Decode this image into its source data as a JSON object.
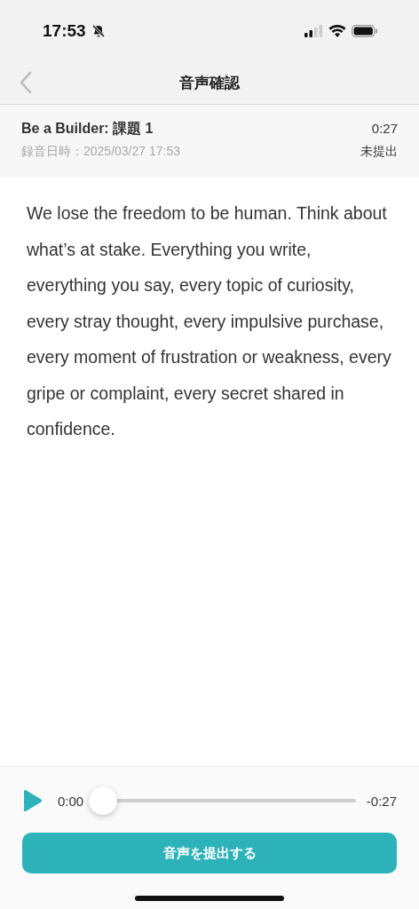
{
  "status_bar": {
    "time": "17:53",
    "silent": true
  },
  "nav": {
    "title": "音声確認"
  },
  "recording": {
    "title": "Be a Builder: 課題 1",
    "recorded_at": "録音日時：2025/03/27 17:53",
    "duration": "0:27",
    "status": "未提出"
  },
  "transcript": "We lose the freedom to be human. Think about what’s at stake. Everything you write, everything you say, every topic of curiosity, every stray thought, every impulsive purchase, every moment of frustration or weakness, every gripe or complaint, every secret shared in confidence.",
  "player": {
    "elapsed": "0:00",
    "remaining": "-0:27",
    "level": 0
  },
  "submit_button": "音声を提出する"
}
